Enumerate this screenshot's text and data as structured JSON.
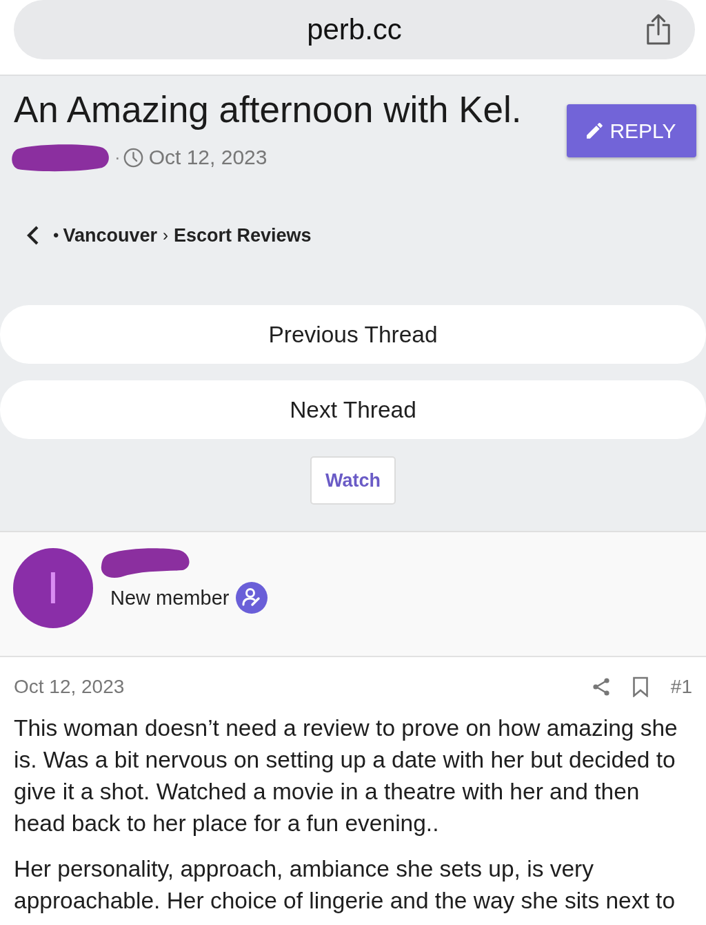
{
  "browser_bar": {
    "url": "perb.cc"
  },
  "thread": {
    "title": "An Amazing afternoon with Kel.",
    "meta_separator": "·",
    "date": "Oct 12, 2023",
    "reply_button": "REPLY"
  },
  "breadcrumb": {
    "bullet": "•",
    "items": [
      "Vancouver",
      "Escort Reviews"
    ],
    "separator": "›"
  },
  "thread_nav": [
    "Previous Thread",
    "Next Thread"
  ],
  "watch_button": "Watch",
  "post": {
    "author": {
      "initial": "I",
      "role": "New member"
    },
    "date": "Oct 12, 2023",
    "number": "#1",
    "paragraphs": [
      "This woman doesn’t need a review to prove on how amazing she is. Was a bit nervous on setting up a date with her but decided to give it a shot. Watched a movie in a theatre with her and then head back to her place for a fun evening..",
      "Her personality, approach, ambiance she sets up, is very approachable. Her choice of lingerie and the way she sits next to"
    ]
  }
}
